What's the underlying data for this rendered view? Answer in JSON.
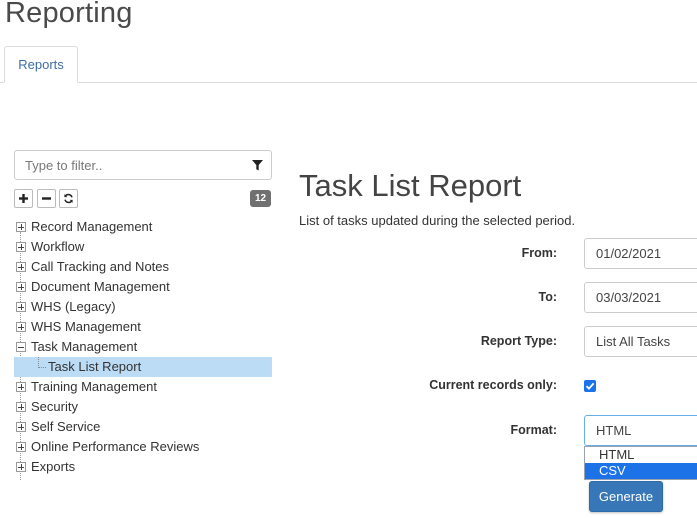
{
  "page": {
    "title": "Reporting"
  },
  "tabs": [
    {
      "label": "Reports",
      "active": true
    }
  ],
  "sidebar": {
    "filter_placeholder": "Type to filter..",
    "count_badge": "12",
    "tree": [
      {
        "label": "Record Management",
        "expanded": false
      },
      {
        "label": "Workflow",
        "expanded": false
      },
      {
        "label": "Call Tracking and Notes",
        "expanded": false
      },
      {
        "label": "Document Management",
        "expanded": false
      },
      {
        "label": "WHS (Legacy)",
        "expanded": false
      },
      {
        "label": "WHS Management",
        "expanded": false
      },
      {
        "label": "Task Management",
        "expanded": true,
        "children": [
          {
            "label": "Task List Report",
            "selected": true
          }
        ]
      },
      {
        "label": "Training Management",
        "expanded": false
      },
      {
        "label": "Security",
        "expanded": false
      },
      {
        "label": "Self Service",
        "expanded": false
      },
      {
        "label": "Online Performance Reviews",
        "expanded": false
      },
      {
        "label": "Exports",
        "expanded": false
      }
    ]
  },
  "report": {
    "title": "Task List Report",
    "description": "List of tasks updated during the selected period.",
    "fields": {
      "from": {
        "label": "From:",
        "value": "01/02/2021"
      },
      "to": {
        "label": "To:",
        "value": "03/03/2021"
      },
      "report_type": {
        "label": "Report Type:",
        "value": "List All Tasks"
      },
      "current_only": {
        "label": "Current records only:",
        "checked": true
      },
      "format": {
        "label": "Format:",
        "value": "HTML",
        "options": [
          "HTML",
          "CSV"
        ],
        "highlighted": "CSV"
      }
    },
    "generate_label": "Generate"
  },
  "colors": {
    "accent": "#3877b7",
    "tab_text": "#3f6ea5",
    "selected_row": "#bcdcf6",
    "dropdown_highlight": "#1e72e8",
    "badge": "#707070"
  }
}
